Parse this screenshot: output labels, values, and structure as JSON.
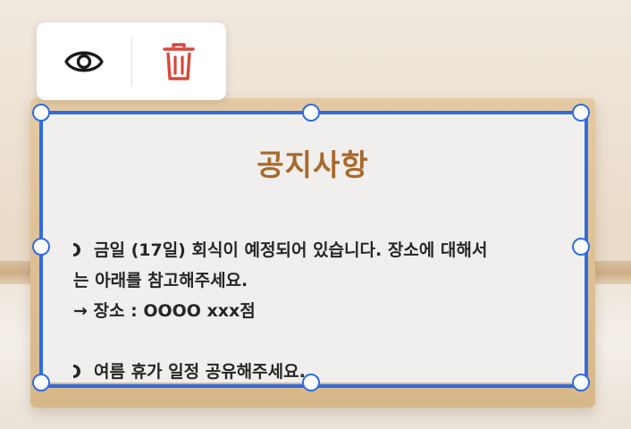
{
  "toolbar": {
    "view_icon": "eye-icon",
    "delete_icon": "trash-icon",
    "delete_color": "#d9483b"
  },
  "notice": {
    "title": "공지사항",
    "title_color": "#a8692c",
    "item1_line1": "금일 (17일) 회식이 예정되어 있습니다. 장소에 대해서",
    "item1_line2": "는 아래를 참고해주세요.",
    "item1_line3": "→ 장소 : OOOO xxx점",
    "item2": "여름 휴가 일정 공유해주세요."
  },
  "selection": {
    "color": "#2f6ce0"
  }
}
